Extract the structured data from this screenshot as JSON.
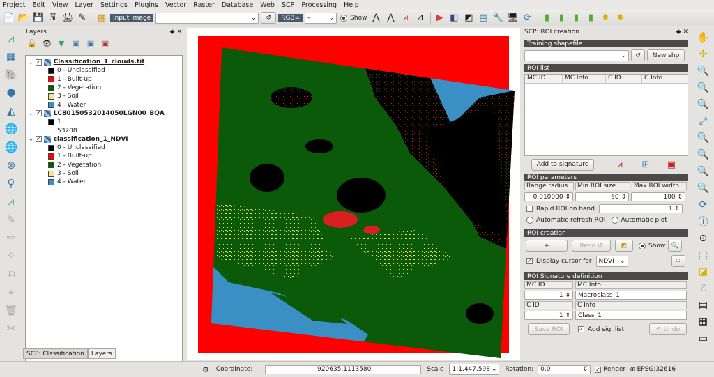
{
  "menubar": [
    "Project",
    "Edit",
    "View",
    "Layer",
    "Settings",
    "Plugins",
    "Vector",
    "Raster",
    "Database",
    "Web",
    "SCP",
    "Processing",
    "Help"
  ],
  "toolbar": {
    "input_image_label": "Input image",
    "rgb_label": "RGB=",
    "rgb_value": "-",
    "show_label": "Show"
  },
  "layers_panel": {
    "title": "Layers",
    "groups": [
      {
        "name": "Classification_1_clouds.tif",
        "items": [
          {
            "label": "0 - Unclassified",
            "color": "#000000"
          },
          {
            "label": "1 - Built-up",
            "color": "#ff0000"
          },
          {
            "label": "2 - Vegetation",
            "color": "#0a5a0a"
          },
          {
            "label": "3 - Soil",
            "color": "#f0e68c"
          },
          {
            "label": "4 - Water",
            "color": "#3a8fc4"
          }
        ]
      },
      {
        "name": "LC80150532014050LGN00_BQA",
        "items": [
          {
            "label": "1",
            "color": "#000000"
          },
          {
            "label": "53208",
            "color": null
          }
        ]
      },
      {
        "name": "classification_1_NDVI",
        "items": [
          {
            "label": "0 - Unclassified",
            "color": "#000000"
          },
          {
            "label": "1 - Built-up",
            "color": "#ff0000"
          },
          {
            "label": "2 - Vegetation",
            "color": "#0a5a0a"
          },
          {
            "label": "3 - Soil",
            "color": "#f0e68c"
          },
          {
            "label": "4 - Water",
            "color": "#3a8fc4"
          }
        ]
      }
    ],
    "tabs": [
      "SCP: Classification",
      "Layers"
    ]
  },
  "scp": {
    "title": "SCP: ROI creation",
    "training_shapefile": "Training shapefile",
    "new_shp": "New shp",
    "roi_list": "ROI list",
    "roi_columns": [
      "MC ID",
      "MC Info",
      "C ID",
      "C Info"
    ],
    "add_to_signature": "Add to signature",
    "roi_parameters": "ROI parameters",
    "range_radius": "Range radius",
    "min_roi_size": "Min ROI size",
    "max_roi_width": "Max ROI width",
    "range_radius_value": "0.010000",
    "min_roi_size_value": "60",
    "max_roi_width_value": "100",
    "rapid_roi": "Rapid ROI on band",
    "rapid_roi_value": "1",
    "auto_refresh": "Automatic refresh ROI",
    "auto_plot": "Automatic  plot",
    "roi_creation": "ROI creation",
    "plus": "+",
    "redo": "Redo ↺",
    "show": "Show",
    "display_cursor": "Display cursor for",
    "cursor_value": "NDVI",
    "sig_def": "ROI Signature definition",
    "mc_id": "MC ID",
    "mc_info": "MC Info",
    "mc_id_value": "1",
    "mc_info_value": "Macroclass_1",
    "c_id": "C ID",
    "c_info": "C Info",
    "c_id_value": "1",
    "c_info_value": "Class_1",
    "save_roi": "Save ROI",
    "add_sig_list": "Add sig. list",
    "undo": "↶ Undo"
  },
  "status": {
    "coordinate_label": "Coordinate:",
    "coordinate_value": "920635,1113580",
    "scale_label": "Scale",
    "scale_value": "1:1,447,598",
    "rotation_label": "Rotation:",
    "rotation_value": "0.0",
    "render_label": "Render",
    "crs": "EPSG:32616"
  }
}
